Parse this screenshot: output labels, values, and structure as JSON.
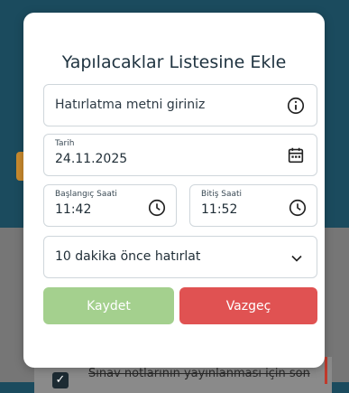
{
  "background": {
    "task_text": "Sınav notlarının yayınlanması için son"
  },
  "modal": {
    "title": "Yapılacaklar Listesine Ekle",
    "reminder_field": {
      "placeholder": "Hatırlatma metni giriniz",
      "icon": "info-icon"
    },
    "date_field": {
      "label": "Tarih",
      "value": "24.11.2025",
      "icon": "calendar-icon"
    },
    "start_time_field": {
      "label": "Başlangıç Saati",
      "value": "11:42",
      "icon": "clock-icon"
    },
    "end_time_field": {
      "label": "Bitiş Saati",
      "value": "11:52",
      "icon": "clock-icon"
    },
    "reminder_select": {
      "value": "10 dakika önce hatırlat",
      "icon": "chevron-down-icon"
    },
    "buttons": {
      "save": "Kaydet",
      "cancel": "Vazgeç"
    }
  },
  "colors": {
    "save_button": "#a4d08e",
    "cancel_button": "#e05252",
    "header_background": "#1b4b5e"
  }
}
